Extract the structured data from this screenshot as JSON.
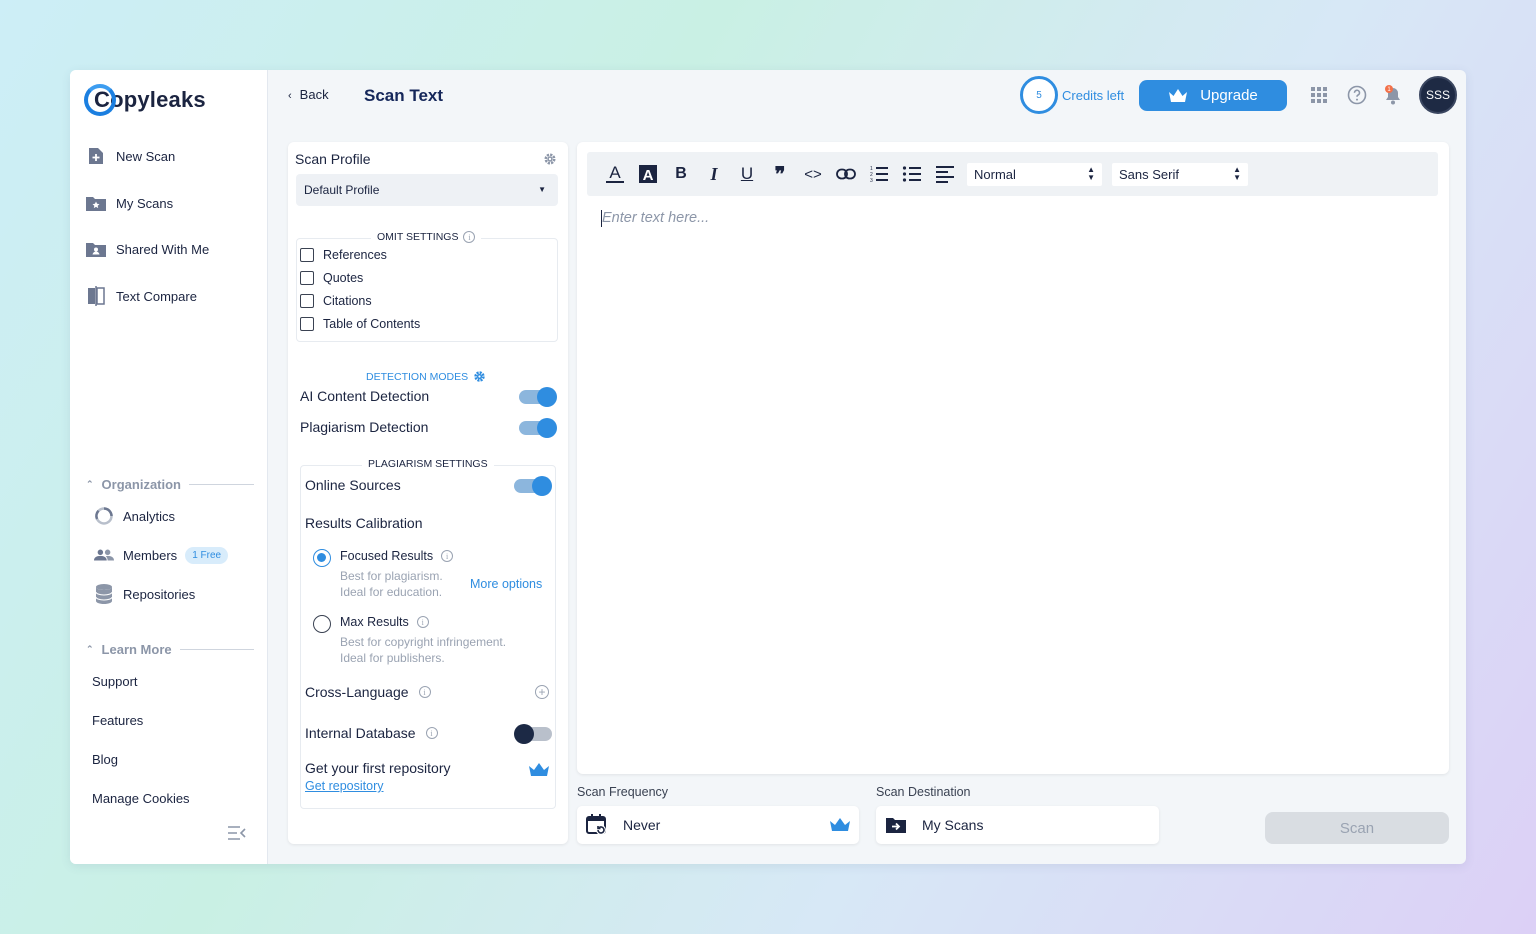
{
  "brand": {
    "name": "Copyleaks",
    "accent": "#2f8de0",
    "dark": "#1b2440"
  },
  "sidebar": {
    "items": [
      {
        "label": "New Scan",
        "icon": "new-scan-icon"
      },
      {
        "label": "My Scans",
        "icon": "folder-star-icon"
      },
      {
        "label": "Shared With Me",
        "icon": "shared-folder-icon"
      },
      {
        "label": "Text Compare",
        "icon": "compare-icon"
      }
    ],
    "organization": {
      "heading": "Organization",
      "items": [
        {
          "label": "Analytics",
          "icon": "analytics-icon"
        },
        {
          "label": "Members",
          "icon": "members-icon",
          "badge": "1 Free"
        },
        {
          "label": "Repositories",
          "icon": "database-icon"
        }
      ]
    },
    "learn_more": {
      "heading": "Learn More",
      "items": [
        "Support",
        "Features",
        "Blog",
        "Manage Cookies"
      ]
    }
  },
  "header": {
    "back_label": "Back",
    "title": "Scan Text",
    "credits_count": "5",
    "credits_label": "Credits left",
    "upgrade_label": "Upgrade",
    "avatar_initials": "SSS"
  },
  "settings": {
    "title": "Scan Profile",
    "profile_value": "Default Profile",
    "omit_heading": "OMIT SETTINGS",
    "omit_options": [
      "References",
      "Quotes",
      "Citations",
      "Table of Contents"
    ],
    "detection_heading": "DETECTION MODES",
    "ai_detection_label": "AI Content Detection",
    "ai_detection_on": true,
    "plagiarism_detection_label": "Plagiarism Detection",
    "plagiarism_detection_on": true,
    "plagiarism_heading": "PLAGIARISM SETTINGS",
    "online_sources_label": "Online Sources",
    "online_sources_on": true,
    "calibration_label": "Results Calibration",
    "focused_label": "Focused Results",
    "focused_desc_1": "Best for plagiarism.",
    "focused_desc_2": "Ideal for education.",
    "more_options": "More options",
    "max_label": "Max Results",
    "max_desc_1": "Best for copyright infringement.",
    "max_desc_2": "Ideal for publishers.",
    "cross_language_label": "Cross-Language",
    "internal_db_label": "Internal Database",
    "internal_db_on": false,
    "repo_prompt": "Get your first repository",
    "repo_link": "Get repository"
  },
  "editor": {
    "placeholder": "Enter text here...",
    "format_select": "Normal",
    "font_select": "Sans Serif"
  },
  "bottom": {
    "frequency_label": "Scan Frequency",
    "frequency_value": "Never",
    "destination_label": "Scan Destination",
    "destination_value": "My Scans",
    "scan_button": "Scan"
  }
}
